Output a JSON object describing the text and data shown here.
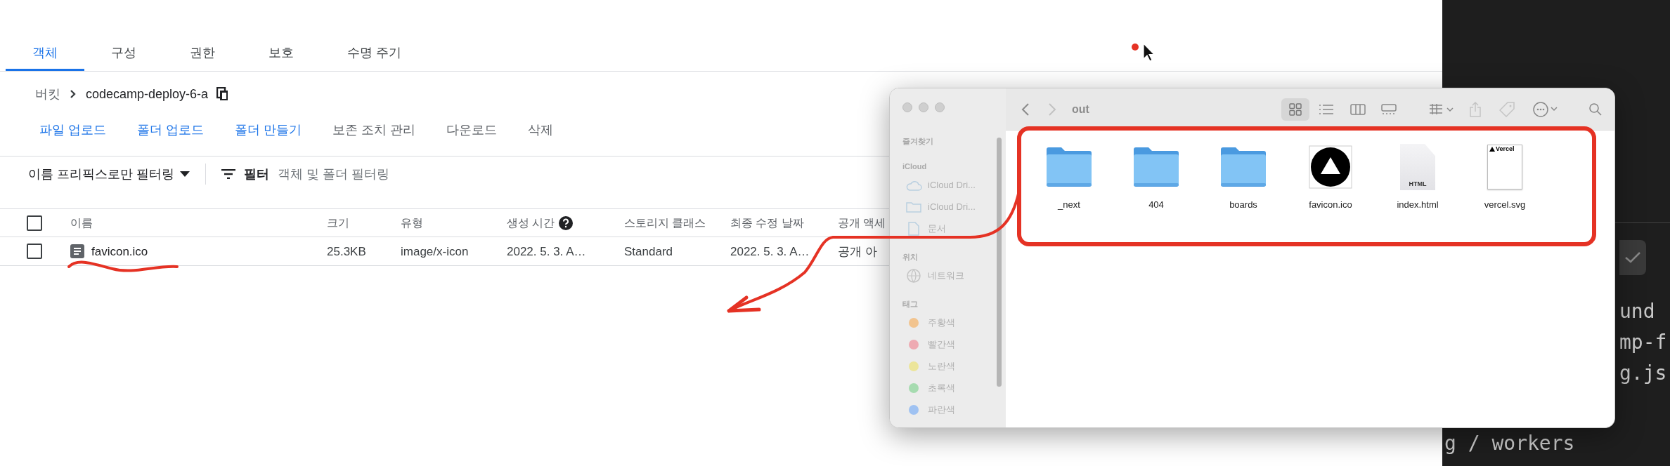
{
  "tabs": [
    {
      "label": "객체",
      "selected": true
    },
    {
      "label": "구성",
      "selected": false
    },
    {
      "label": "권한",
      "selected": false
    },
    {
      "label": "보호",
      "selected": false
    },
    {
      "label": "수명 주기",
      "selected": false
    }
  ],
  "breadcrumb": {
    "root": "버킷",
    "bucket": "codecamp-deploy-6-a"
  },
  "actions": [
    {
      "label": "파일 업로드",
      "disabled": false
    },
    {
      "label": "폴더 업로드",
      "disabled": false
    },
    {
      "label": "폴더 만들기",
      "disabled": false
    },
    {
      "label": "보존 조치 관리",
      "disabled": true
    },
    {
      "label": "다운로드",
      "disabled": true
    },
    {
      "label": "삭제",
      "disabled": true
    }
  ],
  "filter": {
    "mode": "이름 프리픽스로만 필터링",
    "button": "필터",
    "placeholder": "객체 및 폴더 필터링"
  },
  "table": {
    "select_all": {
      "checked": false
    },
    "columns": [
      "이름",
      "크기",
      "유형",
      "생성 시간",
      "스토리지 클래스",
      "최종 수정 날짜",
      "공개 액세"
    ],
    "rows": [
      {
        "checked": false,
        "cells": [
          "favicon.ico",
          "25.3KB",
          "image/x-icon",
          "2022. 5. 3. A…",
          "Standard",
          "2022. 5. 3. A…",
          "공개 아"
        ]
      }
    ]
  },
  "finder": {
    "title": "out",
    "sidebar": [
      {
        "heading": "즐겨찾기"
      },
      {
        "heading": "iCloud",
        "items": [
          {
            "label": "iCloud Dri...",
            "kind": "cloud"
          },
          {
            "label": "iCloud Dri...",
            "kind": "folder"
          },
          {
            "label": "문서",
            "kind": "document"
          }
        ]
      },
      {
        "heading": "위치",
        "items": [
          {
            "label": "네트워크",
            "kind": "network"
          }
        ]
      },
      {
        "heading": "태그",
        "items": [
          {
            "label": "주황색",
            "kind": "tag",
            "color": "#f2c48f"
          },
          {
            "label": "빨간색",
            "kind": "tag",
            "color": "#eeaab2"
          },
          {
            "label": "노란색",
            "kind": "tag",
            "color": "#ece59a"
          },
          {
            "label": "초록색",
            "kind": "tag",
            "color": "#a6dbb0"
          },
          {
            "label": "파란색",
            "kind": "tag",
            "color": "#9fc2f2"
          }
        ]
      }
    ],
    "files": [
      {
        "name": "_next",
        "kind": "folder"
      },
      {
        "name": "404",
        "kind": "folder"
      },
      {
        "name": "boards",
        "kind": "folder"
      },
      {
        "name": "favicon.ico",
        "kind": "logo"
      },
      {
        "name": "index.html",
        "kind": "html",
        "badge": "HTML"
      },
      {
        "name": "vercel.svg",
        "kind": "svg",
        "badge": "Vercel"
      }
    ]
  },
  "terminal": {
    "lines": [
      "und",
      "mp-f",
      "g.js",
      "g / workers"
    ]
  }
}
